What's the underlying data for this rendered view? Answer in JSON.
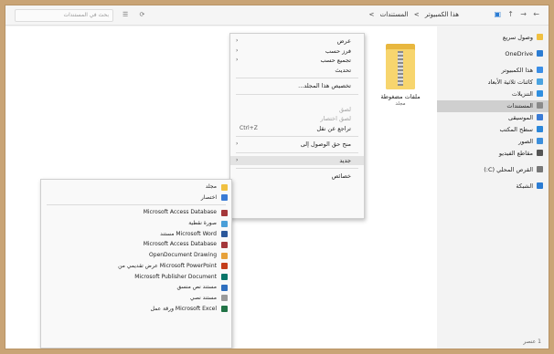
{
  "address": {
    "crumbs": [
      "هذا الكمبيوتر",
      ">",
      "المستندات",
      ">"
    ],
    "search_placeholder": "بحث في المستندات",
    "nav_back": "←",
    "nav_forward": "→",
    "nav_up": "↑",
    "refresh": "⟳",
    "view_icon": "☰"
  },
  "sidebar": {
    "items": [
      {
        "label": "وصول سريع",
        "icon": "star-icon",
        "color": "#f0c040"
      },
      {
        "label": "OneDrive",
        "icon": "cloud-icon",
        "color": "#2b7cd3"
      },
      {
        "label": "هذا الكمبيوتر",
        "icon": "computer-icon",
        "color": "#3a8ee6"
      },
      {
        "label": "كائنات ثلاثية الأبعاد",
        "icon": "cube-icon",
        "color": "#4aa3e0"
      },
      {
        "label": "التنزيلات",
        "icon": "download-icon",
        "color": "#2f8fe0"
      },
      {
        "label": "المستندات",
        "icon": "document-icon",
        "color": "#8a8a8a"
      },
      {
        "label": "الموسيقى",
        "icon": "music-icon",
        "color": "#3a7bd5"
      },
      {
        "label": "سطح المكتب",
        "icon": "desktop-icon",
        "color": "#2b87da"
      },
      {
        "label": "الصور",
        "icon": "picture-icon",
        "color": "#3c8fdc"
      },
      {
        "label": "مقاطع الفيديو",
        "icon": "video-icon",
        "color": "#555555"
      },
      {
        "label": "القرص المحلي (C:)",
        "icon": "drive-icon",
        "color": "#777777"
      },
      {
        "label": "الشبكة",
        "icon": "network-icon",
        "color": "#2b7cd3"
      }
    ],
    "selected_index": 5
  },
  "folder": {
    "name": "ملفات مضغوطة",
    "subtitle": "مجلد"
  },
  "context_menu": {
    "group1": [
      "عرض",
      "فرز حسب",
      "تجميع حسب",
      "تحديث"
    ],
    "customize": "تخصيص هذا المجلد...",
    "group3": [
      {
        "label": "لصق",
        "disabled": true
      },
      {
        "label": "لصق اختصار",
        "disabled": true
      },
      {
        "label": "تراجع عن نقل",
        "shortcut": "Ctrl+Z",
        "disabled": false
      }
    ],
    "give_access": "منح حق الوصول إلى",
    "new_item": "جديد",
    "properties": "خصائص"
  },
  "new_submenu": {
    "items": [
      {
        "label": "مجلد",
        "icon": "folder-icon",
        "color": "#f0c040"
      },
      {
        "label": "اختصار",
        "icon": "shortcut-icon",
        "color": "#3a7bd5"
      }
    ],
    "items2": [
      {
        "label": "Microsoft Access Database",
        "icon": "access-icon",
        "color": "#a4373a"
      },
      {
        "label": "صورة نقطية",
        "icon": "bitmap-icon",
        "color": "#4a9fd8"
      },
      {
        "label": "Microsoft Word مستند",
        "icon": "word-icon",
        "color": "#2b579a"
      },
      {
        "label": "Microsoft Access Database",
        "icon": "access-icon",
        "color": "#a4373a"
      },
      {
        "label": "OpenDocument Drawing",
        "icon": "draw-icon",
        "color": "#e7a13a"
      },
      {
        "label": "Microsoft PowerPoint عرض تقديمي من",
        "icon": "powerpoint-icon",
        "color": "#c43e1c"
      },
      {
        "label": "Microsoft Publisher Document",
        "icon": "publisher-icon",
        "color": "#077568"
      },
      {
        "label": "مستند نص منسق",
        "icon": "rtf-icon",
        "color": "#2f6fbf"
      },
      {
        "label": "مستند نصي",
        "icon": "text-icon",
        "color": "#9a9a9a"
      },
      {
        "label": "Microsoft Excel ورقة عمل",
        "icon": "excel-icon",
        "color": "#217346"
      }
    ]
  },
  "status_text": "1 عنصر"
}
